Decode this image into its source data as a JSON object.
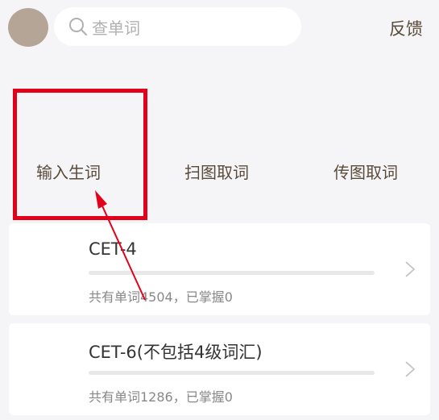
{
  "header": {
    "search_placeholder": "查单词",
    "feedback_label": "反馈"
  },
  "actions": [
    {
      "label": "输入生词"
    },
    {
      "label": "扫图取词"
    },
    {
      "label": "传图取词"
    }
  ],
  "wordbooks": [
    {
      "title": "CET-4",
      "stats": "共有单词4504，已掌握0",
      "progress": 0
    },
    {
      "title": "CET-6(不包括4级词汇)",
      "stats": "共有单词1286，已掌握0",
      "progress": 0
    }
  ],
  "colors": {
    "accent": "#5a4a3a",
    "highlight": "#e3001b",
    "avatar": "#b5a596"
  },
  "icons": {
    "search": "search-icon",
    "chevron": "chevron-right-icon"
  }
}
